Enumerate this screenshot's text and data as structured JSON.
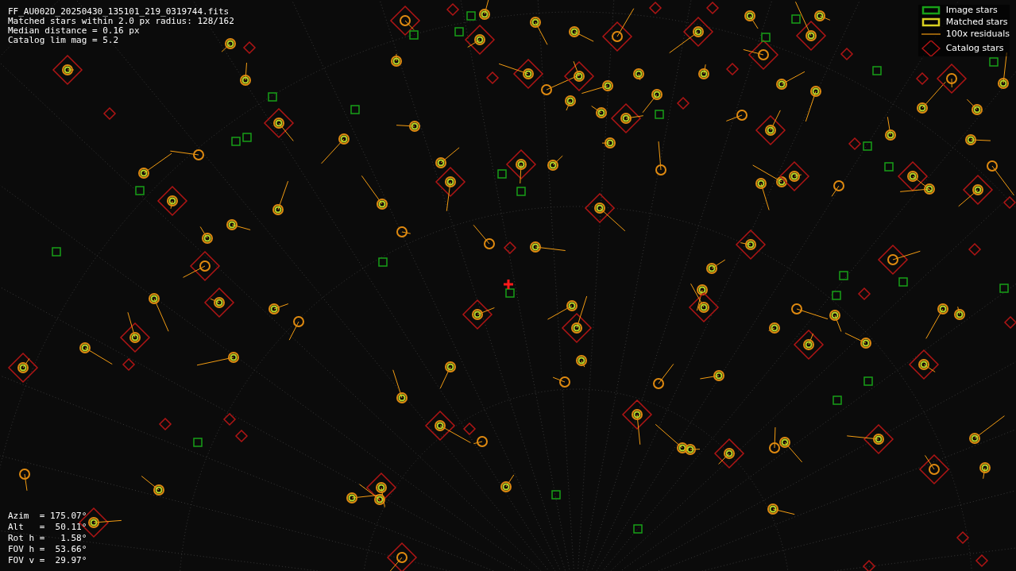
{
  "info_lines": [
    "FF_AU002D_20250430_135101_219_0319744.fits",
    "Matched stars within 2.0 px radius: 128/162",
    "Median distance = 0.16 px",
    "Catalog lim mag = 5.2"
  ],
  "legend": [
    {
      "kind": "image",
      "label": "Image stars"
    },
    {
      "kind": "matched",
      "label": "Matched stars"
    },
    {
      "kind": "residual",
      "label": "100x residuals"
    },
    {
      "kind": "catalog",
      "label": "Catalog stars"
    }
  ],
  "pointing_lines": [
    "Azim  = 175.07°",
    "Alt   =  50.11°",
    "Rot h =   1.58°",
    "FOV h =  53.66°",
    "FOV v =  29.97°"
  ]
}
